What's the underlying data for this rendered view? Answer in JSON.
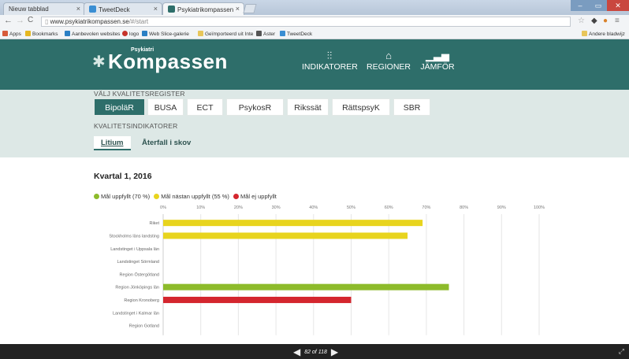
{
  "browser": {
    "tabs": [
      {
        "title": "Nieuw tabblad"
      },
      {
        "title": "TweetDeck"
      },
      {
        "title": "Psykiatrikompassen"
      }
    ],
    "url_host": "www.psykiatrikompassen.se",
    "url_path": "/#/start",
    "bookmarks": [
      {
        "label": "Apps"
      },
      {
        "label": "Bookmarks"
      },
      {
        "label": "Aanbevolen websites"
      },
      {
        "label": "logo"
      },
      {
        "label": "Web Slice-galerie"
      },
      {
        "label": "Geïmporteerd uit Inte"
      },
      {
        "label": "Aster"
      },
      {
        "label": "TweetDeck"
      }
    ],
    "other_bookmarks": "Andere bladwijz"
  },
  "header": {
    "logo_small": "Psykiatri",
    "logo_main": "Kompassen",
    "nav": [
      {
        "label": "INDIKATORER",
        "icon": "sliders-icon"
      },
      {
        "label": "REGIONER",
        "icon": "building-icon"
      },
      {
        "label": "JÄMFÖR",
        "icon": "bar-chart-icon"
      }
    ]
  },
  "registers": {
    "section_label": "VÄLJ KVALITETSREGISTER",
    "items": [
      "BipoläR",
      "BUSA",
      "ECT",
      "PsykosR",
      "Rikssät",
      "RättspsyK",
      "SBR"
    ],
    "active": "BipoläR"
  },
  "indicators": {
    "section_label": "KVALITETSINDIKATORER",
    "tabs": [
      "Litium",
      "Återfall i skov"
    ],
    "active": "Litium"
  },
  "period": "Kvartal 1, 2016",
  "legend": [
    {
      "label": "Mål uppfyllt (70 %)",
      "color": "#8dbb2b"
    },
    {
      "label": "Mål nästan uppfyllt (55 %)",
      "color": "#e8d41e"
    },
    {
      "label": "Mål ej uppfyllt",
      "color": "#d4262e"
    }
  ],
  "chart_data": {
    "type": "bar",
    "orientation": "horizontal",
    "x_ticks": [
      "0%",
      "10%",
      "20%",
      "30%",
      "40%",
      "50%",
      "60%",
      "70%",
      "80%",
      "90%",
      "100%"
    ],
    "xlim": [
      0,
      100
    ],
    "grid": true,
    "categories": [
      "Riket",
      "Stockholms läns landsting",
      "Landstinget i Uppsala län",
      "Landstinget Sörmland",
      "Region Östergötland",
      "Region Jönköpings län",
      "Region Kronoberg",
      "Landstinget i Kalmar län",
      "Region Gotland"
    ],
    "values": [
      69,
      65,
      null,
      null,
      null,
      76,
      50,
      null,
      null
    ],
    "colors": [
      "#e8d41e",
      "#e8d41e",
      null,
      null,
      null,
      "#8dbb2b",
      "#d4262e",
      null,
      null
    ]
  },
  "footer": {
    "pager_text": "82 of 118"
  }
}
